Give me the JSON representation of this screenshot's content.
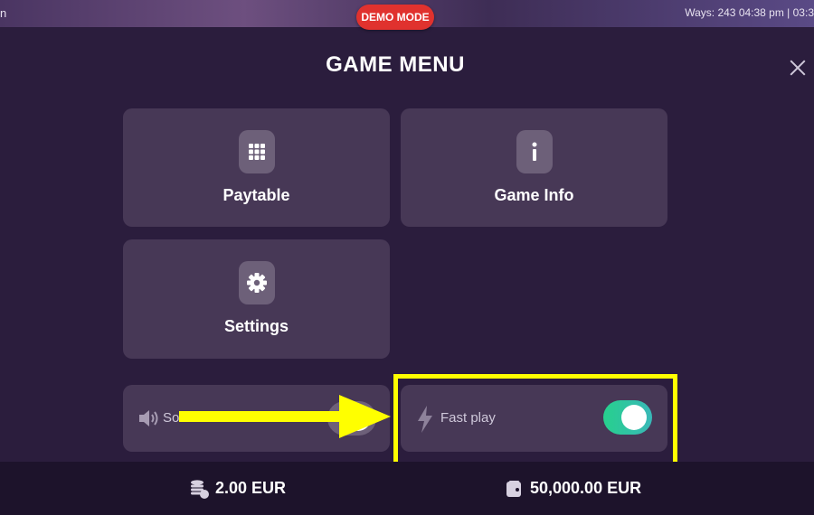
{
  "top_bar": {
    "left_text": "n",
    "right_text": "Ways: 243  04:38 pm | 03:3",
    "demo_badge": "DEMO MODE"
  },
  "menu": {
    "title": "GAME MENU",
    "close_icon": "close-icon",
    "cards": [
      {
        "label": "Paytable",
        "icon": "grid-icon"
      },
      {
        "label": "Game Info",
        "icon": "info-icon"
      },
      {
        "label": "Settings",
        "icon": "gear-icon"
      }
    ],
    "sound": {
      "label": "So",
      "icon": "speaker-icon",
      "enabled": true
    },
    "fast_play": {
      "label": "Fast play",
      "icon": "lightning-icon",
      "enabled": true
    }
  },
  "bottom_bar": {
    "bet": {
      "value": "2.00 EUR",
      "icon": "coins-icon"
    },
    "balance": {
      "value": "50,000.00 EUR",
      "icon": "wallet-icon"
    }
  },
  "annotation": {
    "highlight_color": "#ffff00",
    "arrow_color": "#ffff00"
  },
  "colors": {
    "accent_green": "#27d08d",
    "accent_teal": "#39b8b8",
    "badge_red": "#e0322e",
    "panel": "#473856",
    "background": "#2b1d3d"
  }
}
